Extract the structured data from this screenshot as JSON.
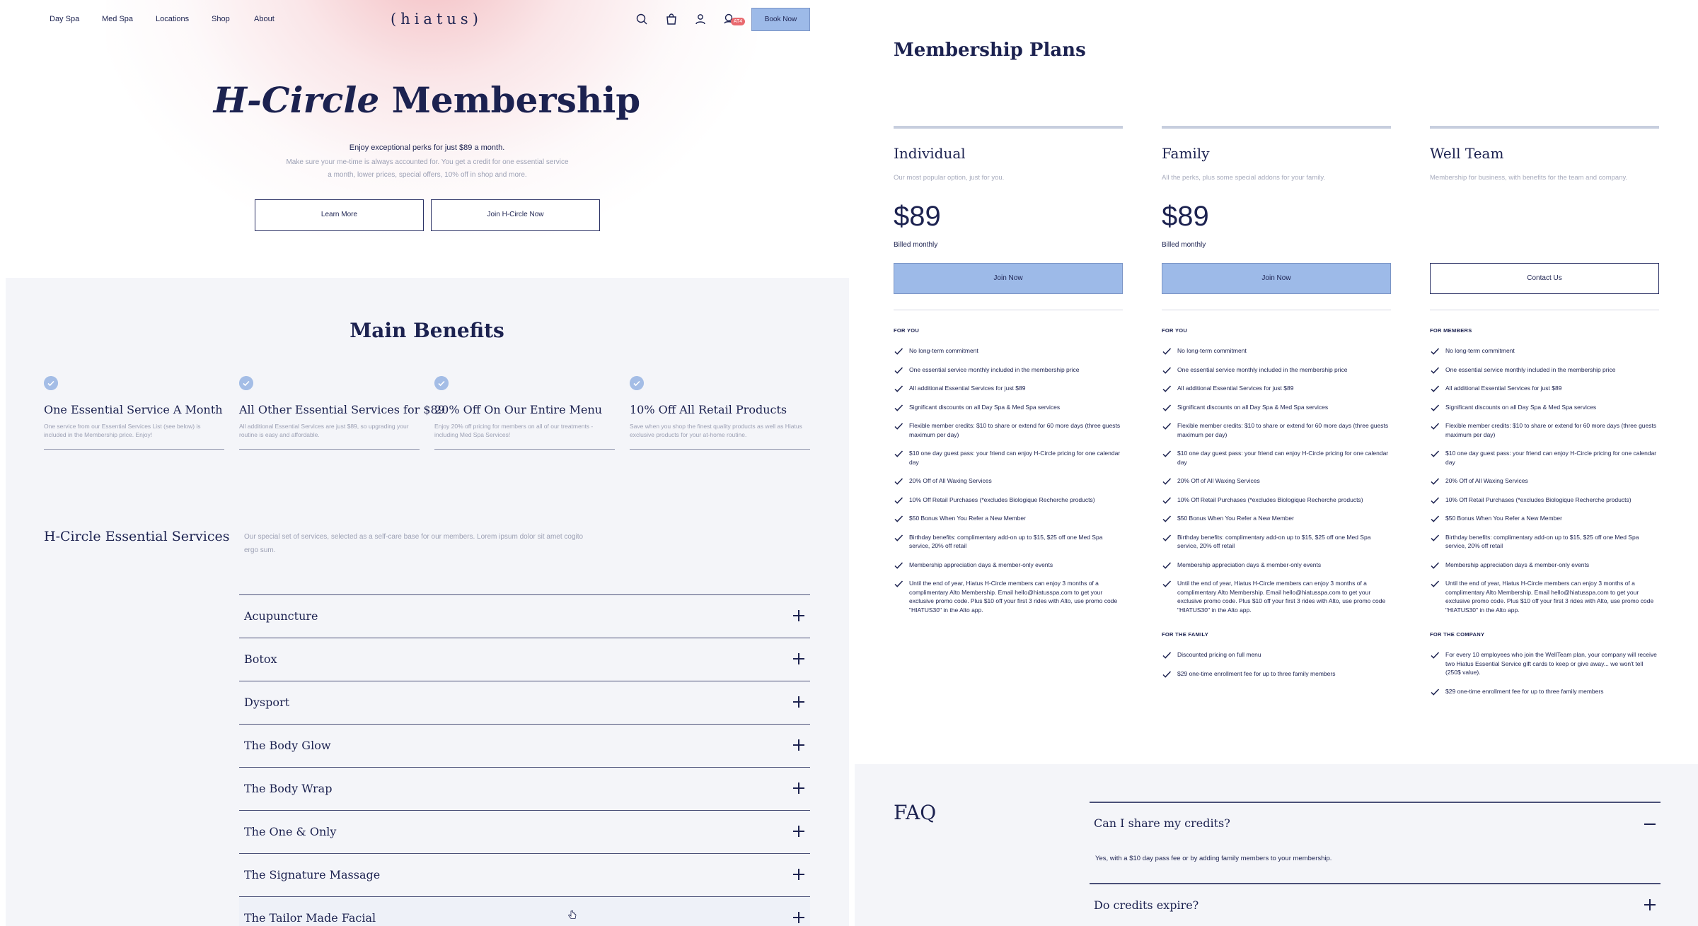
{
  "nav": {
    "links": [
      "Day Spa",
      "Med Spa",
      "Locations",
      "Shop",
      "About"
    ],
    "logo": "(hiatus)",
    "cart_badge": "AT4",
    "book_now": "Book Now"
  },
  "hero": {
    "title_italic": "H-Circle",
    "title_rest": " Membership",
    "subtitle": "Enjoy exceptional perks for just $89 a month.",
    "description": "Make sure your me-time is always accounted for. You get a credit for one essential service a month, lower prices, special offers, 10% off in shop and more.",
    "learn_more": "Learn More",
    "join": "Join H-Circle Now"
  },
  "benefits": {
    "title": "Main Benefits",
    "items": [
      {
        "title": "One Essential Service A Month",
        "desc": "One service from our Essential Services List (see below) is included in the Membership price. Enjoy!"
      },
      {
        "title": "All Other Essential Services for $89",
        "desc": "All additional Essential Services are just $89, so upgrading your routine is easy and affordable."
      },
      {
        "title": "20% Off On Our Entire Menu",
        "desc": "Enjoy 20% off pricing for members on all of our treatments - including Med Spa Services!"
      },
      {
        "title": "10% Off All Retail Products",
        "desc": "Save when you shop the finest quality products as well as Hiatus exclusive products for your at-home routine."
      }
    ]
  },
  "essential": {
    "title": "H-Circle Essential Services",
    "description": "Our special set of services, selected as a self-care base for our members. Lorem ipsum dolor sit amet cogito ergo sum.",
    "items": [
      "Acupuncture",
      "Botox",
      "Dysport",
      "The Body Glow",
      "The Body Wrap",
      "The One & Only",
      "The Signature Massage",
      "The Tailor Made Facial"
    ]
  },
  "plans": {
    "title": "Membership Plans",
    "columns": [
      {
        "name": "Individual",
        "desc": "Our most popular option, just for you.",
        "price": "$89",
        "billed": "Billed monthly",
        "button": "Join Now",
        "sections": [
          {
            "head": "FOR YOU",
            "features": [
              "No long-term commitment",
              "One essential service monthly included in the membership price",
              "All additional Essential Services for just $89",
              "Significant discounts on all Day Spa & Med Spa services",
              "Flexible member credits: $10 to share or extend for 60 more days (three guests maximum per day)",
              "$10 one day guest pass: your friend can enjoy H-Circle pricing for one calendar day",
              "20% Off of All Waxing Services",
              "10% Off Retail Purchases (*excludes Biologique Recherche products)",
              "$50 Bonus When You Refer a New Member",
              "Birthday benefits: complimentary add-on up to $15, $25 off one Med Spa service, 20% off retail",
              "Membership appreciation days & member-only events",
              "Until the end of year, Hiatus H-Circle members can enjoy 3 months of a complimentary Alto Membership. Email hello@hiatusspa.com to get your exclusive promo code. Plus $10 off your first 3 rides with Alto, use promo code \"HIATUS30\" in the Alto app."
            ]
          }
        ]
      },
      {
        "name": "Family",
        "desc": "All the perks, plus some special addons for your family.",
        "price": "$89",
        "billed": "Billed monthly",
        "button": "Join Now",
        "sections": [
          {
            "head": "FOR YOU",
            "features": [
              "No long-term commitment",
              "One essential service monthly included in the membership price",
              "All additional Essential Services for just $89",
              "Significant discounts on all Day Spa & Med Spa services",
              "Flexible member credits: $10 to share or extend for 60 more days (three guests maximum per day)",
              "$10 one day guest pass: your friend can enjoy H-Circle pricing for one calendar day",
              "20% Off of All Waxing Services",
              "10% Off Retail Purchases (*excludes Biologique Recherche products)",
              "$50 Bonus When You Refer a New Member",
              "Birthday benefits: complimentary add-on up to $15, $25 off one Med Spa service, 20% off retail",
              "Membership appreciation days & member-only events",
              "Until the end of year, Hiatus H-Circle members can enjoy 3 months of a complimentary Alto Membership. Email hello@hiatusspa.com to get your exclusive promo code. Plus $10 off your first 3 rides with Alto, use promo code \"HIATUS30\" in the Alto app."
            ]
          },
          {
            "head": "FOR THE FAMILY",
            "features": [
              "Discounted pricing on full menu",
              "$29 one-time enrollment fee for up to three family members"
            ]
          }
        ]
      },
      {
        "name": "Well Team",
        "desc": "Membership for business, with benefits for the team and company.",
        "price": "",
        "billed": "",
        "button": "Contact Us",
        "sections": [
          {
            "head": "FOR MEMBERS",
            "features": [
              "No long-term commitment",
              "One essential service monthly included in the membership price",
              "All additional Essential Services for just $89",
              "Significant discounts on all Day Spa & Med Spa services",
              "Flexible member credits: $10 to share or extend for 60 more days (three guests maximum per day)",
              "$10 one day guest pass: your friend can enjoy H-Circle pricing for one calendar day",
              "20% Off of All Waxing Services",
              "10% Off Retail Purchases (*excludes Biologique Recherche products)",
              "$50 Bonus When You Refer a New Member",
              "Birthday benefits: complimentary add-on up to $15, $25 off one Med Spa service, 20% off retail",
              "Membership appreciation days & member-only events",
              "Until the end of year, Hiatus H-Circle members can enjoy 3 months of a complimentary Alto Membership. Email hello@hiatusspa.com to get your exclusive promo code. Plus $10 off your first 3 rides with Alto, use promo code \"HIATUS30\" in the Alto app."
            ]
          },
          {
            "head": "FOR THE COMPANY",
            "features": [
              "For every 10 employees who join the WellTeam plan, your company will receive two Hiatus Essential Service gift cards to keep or give away... we won't tell (250$ value).",
              "$29 one-time enrollment fee for up to three family members"
            ]
          }
        ]
      }
    ]
  },
  "faq": {
    "title": "FAQ",
    "items": [
      {
        "q": "Can I share my credits?",
        "a": "Yes, with a $10 day pass fee or by adding family members to your membership.",
        "open": true
      },
      {
        "q": "Do credits expire?",
        "a": "",
        "open": false
      }
    ]
  },
  "colors": {
    "navy": "#1c2250",
    "accent_blue": "#9dbae8",
    "check_blue": "#a4bde6",
    "badge_red": "#e9696f",
    "gray_bg": "#f4f5f9"
  }
}
